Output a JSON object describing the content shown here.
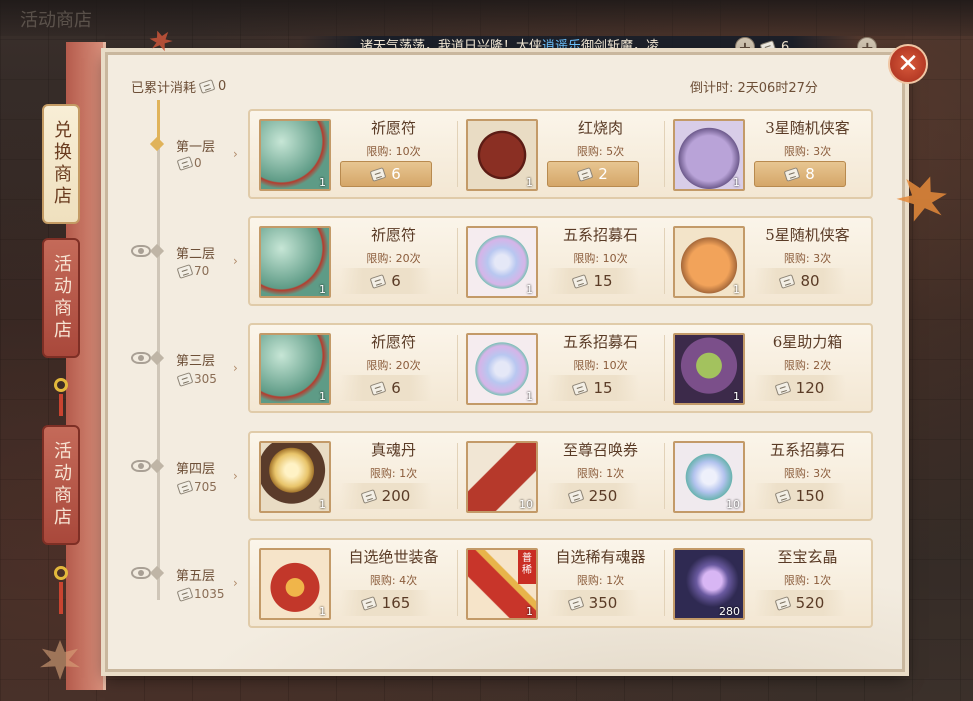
{
  "top": {
    "faded_title": "活动商店",
    "marquee_prefix": "诸天气荡荡，我道日兴隆！大侠",
    "marquee_name": "逍遥乐",
    "marquee_suffix": "御剑斩魔，凌",
    "ticket_count": "6",
    "plus_label": "+"
  },
  "close_label": "✕",
  "tabs": [
    {
      "label": "兑换商店",
      "active": true
    },
    {
      "label": "活动商店",
      "active": false
    },
    {
      "label": "活动商店",
      "active": false
    }
  ],
  "header": {
    "spent_label": "已累计消耗",
    "spent_value": "0",
    "countdown": "倒计时: 2天06时27分"
  },
  "tiers": [
    {
      "label": "第一层",
      "cost": "0"
    },
    {
      "label": "第二层",
      "cost": "70"
    },
    {
      "label": "第三层",
      "cost": "305"
    },
    {
      "label": "第四层",
      "cost": "705"
    },
    {
      "label": "第五层",
      "cost": "1035"
    }
  ],
  "rows": [
    [
      {
        "name": "祈愿符",
        "limit": "限购: 10次",
        "price": "6",
        "qty": "1",
        "art": "art-green",
        "style": "gold"
      },
      {
        "name": "红烧肉",
        "limit": "限购: 5次",
        "price": "2",
        "qty": "1",
        "art": "art-meat",
        "style": "gold"
      },
      {
        "name": "3星随机侠客",
        "limit": "限购: 3次",
        "price": "8",
        "qty": "1",
        "art": "art-bag",
        "style": "gold"
      }
    ],
    [
      {
        "name": "祈愿符",
        "limit": "限购: 20次",
        "price": "6",
        "qty": "1",
        "art": "art-green",
        "style": "plain"
      },
      {
        "name": "五系招募石",
        "limit": "限购: 10次",
        "price": "15",
        "qty": "1",
        "art": "art-stone",
        "style": "plain"
      },
      {
        "name": "5星随机侠客",
        "limit": "限购: 3次",
        "price": "80",
        "qty": "1",
        "art": "art-bag5",
        "style": "plain"
      }
    ],
    [
      {
        "name": "祈愿符",
        "limit": "限购: 20次",
        "price": "6",
        "qty": "1",
        "art": "art-green",
        "style": "plain"
      },
      {
        "name": "五系招募石",
        "limit": "限购: 10次",
        "price": "15",
        "qty": "1",
        "art": "art-stone",
        "style": "plain"
      },
      {
        "name": "6星助力箱",
        "limit": "限购: 2次",
        "price": "120",
        "qty": "1",
        "art": "art-box6",
        "style": "plain"
      }
    ],
    [
      {
        "name": "真魂丹",
        "limit": "限购: 1次",
        "price": "200",
        "qty": "1",
        "art": "art-pearl",
        "style": "plain"
      },
      {
        "name": "至尊召唤券",
        "limit": "限购: 1次",
        "price": "250",
        "qty": "10",
        "art": "art-scroll",
        "style": "plain"
      },
      {
        "name": "五系招募石",
        "limit": "限购: 3次",
        "price": "150",
        "qty": "10",
        "art": "art-stone2",
        "style": "plain"
      }
    ],
    [
      {
        "name": "自选绝世装备",
        "limit": "限购: 4次",
        "price": "165",
        "qty": "1",
        "art": "art-chest",
        "style": "plain"
      },
      {
        "name": "自选稀有魂器",
        "limit": "限购: 1次",
        "price": "350",
        "qty": "1",
        "art": "art-weapon",
        "style": "plain",
        "tag": "普稀"
      },
      {
        "name": "至宝玄晶",
        "limit": "限购: 1次",
        "price": "520",
        "qty": "280",
        "art": "art-gem",
        "style": "plain"
      }
    ]
  ]
}
